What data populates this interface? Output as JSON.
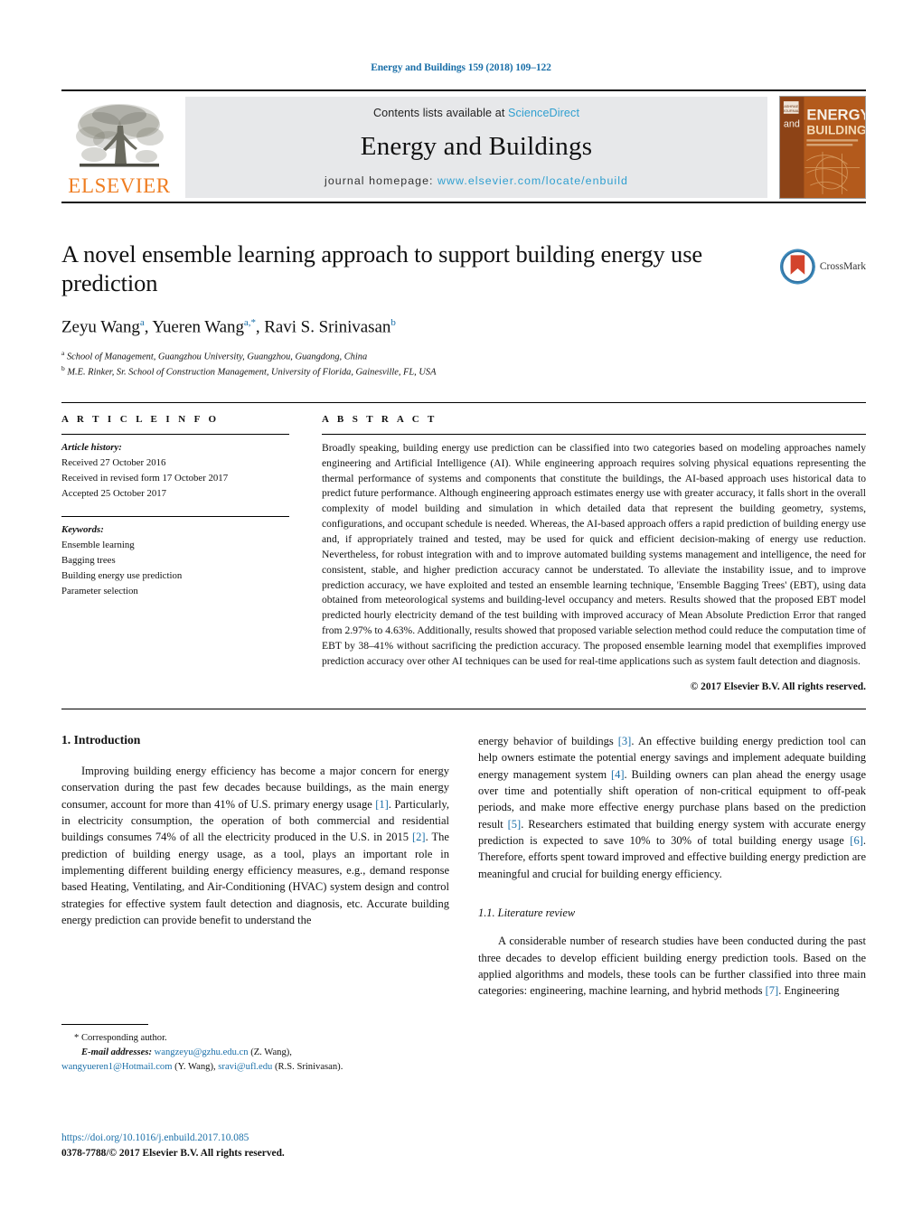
{
  "running_head": "Energy and Buildings 159 (2018) 109–122",
  "masthead": {
    "publisher_name": "ELSEVIER",
    "contents_prefix": "Contents lists available at ",
    "contents_link": "ScienceDirect",
    "journal_name": "Energy and Buildings",
    "homepage_prefix": "journal homepage: ",
    "homepage_url": "www.elsevier.com/locate/enbuild",
    "cover": {
      "line_and": "and",
      "line_energy": "ENERGY",
      "line_buildings": "BUILDINGS"
    },
    "colors": {
      "elsevier_orange": "#ef7d21",
      "link_blue": "#2f9fd0",
      "panel_grey": "#e7e8ea",
      "cover_orange": "#b85b1e"
    }
  },
  "article": {
    "title": "A novel ensemble learning approach to support building energy use prediction",
    "authors": [
      {
        "name": "Zeyu Wang",
        "marks": "a"
      },
      {
        "name": "Yueren Wang",
        "marks": "a,*"
      },
      {
        "name": "Ravi S. Srinivasan",
        "marks": "b"
      }
    ],
    "authors_line_plain": "Zeyu Wang a, Yueren Wang a,*, Ravi S. Srinivasan b",
    "affiliations": [
      {
        "mark": "a",
        "text": "School of Management, Guangzhou University, Guangzhou, Guangdong, China"
      },
      {
        "mark": "b",
        "text": "M.E. Rinker, Sr. School of Construction Management, University of Florida, Gainesville, FL, USA"
      }
    ],
    "crossmark_label": "CrossMark"
  },
  "article_info": {
    "heading": "A R T I C L E   I N F O",
    "history_label": "Article history:",
    "history": [
      "Received 27 October 2016",
      "Received in revised form 17 October 2017",
      "Accepted 25 October 2017"
    ],
    "keywords_label": "Keywords:",
    "keywords": [
      "Ensemble learning",
      "Bagging trees",
      "Building energy use prediction",
      "Parameter selection"
    ]
  },
  "abstract": {
    "heading": "A B S T R A C T",
    "text": "Broadly speaking, building energy use prediction can be classified into two categories based on modeling approaches namely engineering and Artificial Intelligence (AI). While engineering approach requires solving physical equations representing the thermal performance of systems and components that constitute the buildings, the AI-based approach uses historical data to predict future performance. Although engineering approach estimates energy use with greater accuracy, it falls short in the overall complexity of model building and simulation in which detailed data that represent the building geometry, systems, configurations, and occupant schedule is needed. Whereas, the AI-based approach offers a rapid prediction of building energy use and, if appropriately trained and tested, may be used for quick and efficient decision-making of energy use reduction. Nevertheless, for robust integration with and to improve automated building systems management and intelligence, the need for consistent, stable, and higher prediction accuracy cannot be understated. To alleviate the instability issue, and to improve prediction accuracy, we have exploited and tested an ensemble learning technique, 'Ensemble Bagging Trees' (EBT), using data obtained from meteorological systems and building-level occupancy and meters. Results showed that the proposed EBT model predicted hourly electricity demand of the test building with improved accuracy of Mean Absolute Prediction Error that ranged from 2.97% to 4.63%. Additionally, results showed that proposed variable selection method could reduce the computation time of EBT by 38–41% without sacrificing the prediction accuracy. The proposed ensemble learning model that exemplifies improved prediction accuracy over other AI techniques can be used for real-time applications such as system fault detection and diagnosis.",
    "copyright": "© 2017 Elsevier B.V. All rights reserved."
  },
  "body": {
    "section1_heading": "1.  Introduction",
    "left_p1": "Improving building energy efficiency has become a major concern for energy conservation during the past few decades because buildings, as the main energy consumer, account for more than 41% of U.S. primary energy usage [1]. Particularly, in electricity consumption, the operation of both commercial and residential buildings consumes 74% of all the electricity produced in the U.S. in 2015 [2]. The prediction of building energy usage, as a tool, plays an important role in implementing different building energy efficiency measures, e.g., demand response based Heating, Ventilating, and Air-Conditioning (HVAC) system design and control strategies for effective system fault detection and diagnosis, etc. Accurate building energy prediction can provide benefit to understand the",
    "right_p1": "energy behavior of buildings [3]. An effective building energy prediction tool can help owners estimate the potential energy savings and implement adequate building energy management system [4]. Building owners can plan ahead the energy usage over time and potentially shift operation of non-critical equipment to off-peak periods, and make more effective energy purchase plans based on the prediction result [5]. Researchers estimated that building energy system with accurate energy prediction is expected to save 10% to 30% of total building energy usage [6]. Therefore, efforts spent toward improved and effective building energy prediction are meaningful and crucial for building energy efficiency.",
    "section11_heading": "1.1.  Literature review",
    "right_p2": "A considerable number of research studies have been conducted during the past three decades to develop efficient building energy prediction tools. Based on the applied algorithms and models, these tools can be further classified into three main categories: engineering, machine learning, and hybrid methods [7]. Engineering"
  },
  "footnote": {
    "corresponding": "* Corresponding author.",
    "email_label": "E-mail addresses:",
    "emails": [
      {
        "address": "wangzeyu@gzhu.edu.cn",
        "owner": "(Z. Wang),"
      },
      {
        "address": "wangyueren1@Hotmail.com",
        "owner": "(Y. Wang),"
      },
      {
        "address": "sravi@ufl.edu",
        "owner": "(R.S. Srinivasan)."
      }
    ]
  },
  "footer": {
    "doi": "https://doi.org/10.1016/j.enbuild.2017.10.085",
    "issn_line": "0378-7788/© 2017 Elsevier B.V. All rights reserved."
  }
}
